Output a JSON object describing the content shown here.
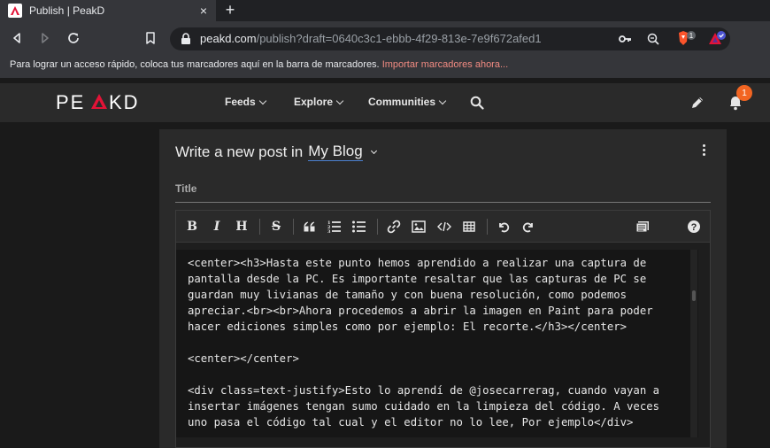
{
  "browser": {
    "tab_title": "Publish | PeakD",
    "tab_close": "×",
    "new_tab": "+",
    "url_host": "peakd.com",
    "url_path": "/publish?draft=0640c3c1-ebbb-4f29-813e-7e9f672afed1",
    "brave_badge": "1",
    "bookmarks_text": "Para lograr un acceso rápido, coloca tus marcadores aquí en la barra de marcadores.",
    "bookmarks_link": "Importar marcadores ahora..."
  },
  "site": {
    "logo": "PEAKD",
    "menu": [
      {
        "label": "Feeds"
      },
      {
        "label": "Explore"
      },
      {
        "label": "Communities"
      }
    ],
    "notification_count": "1"
  },
  "editor": {
    "heading_prefix": "Write a new post in",
    "blog_name": "My Blog",
    "title_placeholder": "Title",
    "toolbar": {
      "bold": "B",
      "italic": "I",
      "heading": "H",
      "strike": "S"
    },
    "lines": [
      "<center><h3>Hasta este punto hemos aprendido a realizar una captura de",
      "pantalla desde la PC. Es importante resaltar que las capturas de PC se",
      "guardan muy livianas de tamaño y con buena resolución, como podemos",
      "apreciar.<br><br>Ahora procedemos a abrir la imagen en Paint para poder",
      "hacer ediciones simples como por ejemplo: El recorte.</h3></center>",
      "",
      "<center></center>",
      "",
      "<div class=text-justify>Esto lo aprendí de @josecarrerag, cuando vayan a",
      "insertar imágenes tengan sumo cuidado en la limpieza del código. A veces",
      "uno pasa el código tal cual y el editor no lo lee, Por ejemplo</div>"
    ]
  },
  "colors": {
    "accent_link": "#4c80cf",
    "logo_red": "#e31337",
    "badge_orange": "#f26522"
  }
}
